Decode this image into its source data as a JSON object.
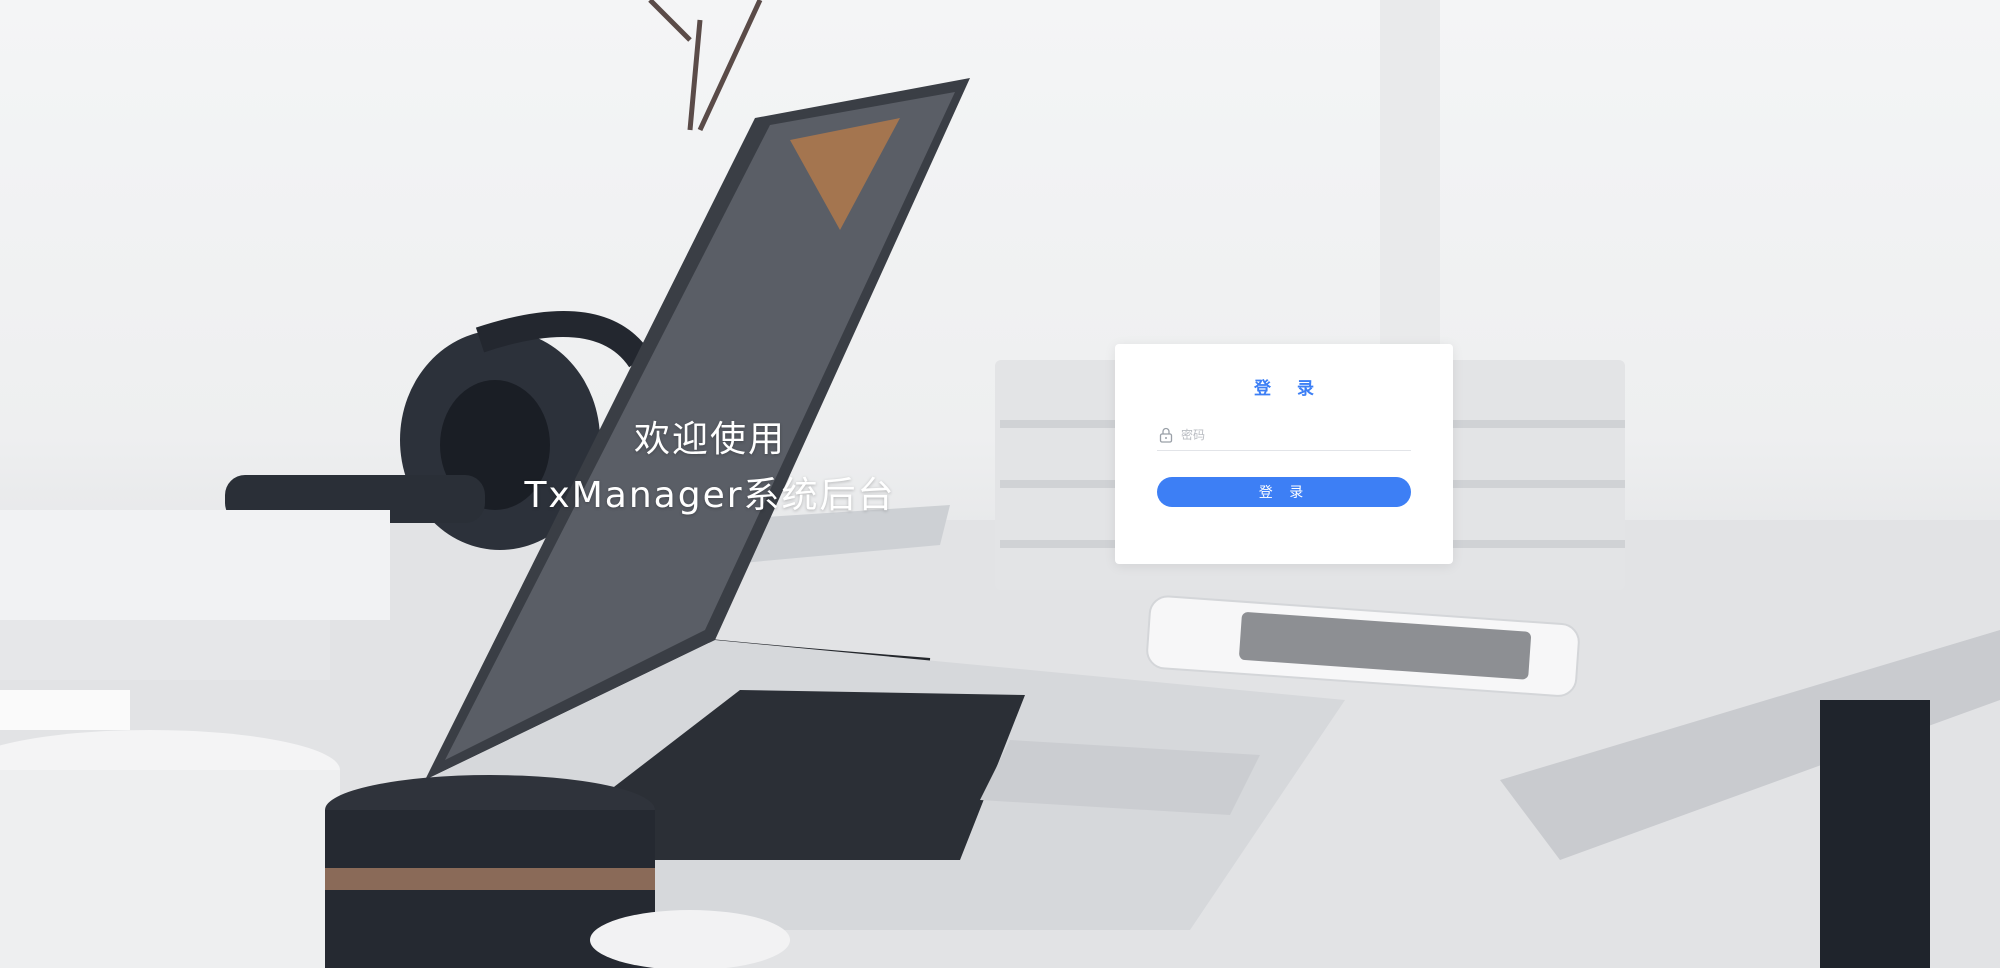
{
  "welcome": {
    "line1": "欢迎使用",
    "line2": "TxManager系统后台"
  },
  "login": {
    "title": "登 录",
    "password_placeholder": "密码",
    "password_icon": "lock-icon",
    "submit_label": "登 录"
  },
  "colors": {
    "accent": "#3d7ff5",
    "card_background": "#ffffff",
    "welcome_text": "#ffffff"
  }
}
